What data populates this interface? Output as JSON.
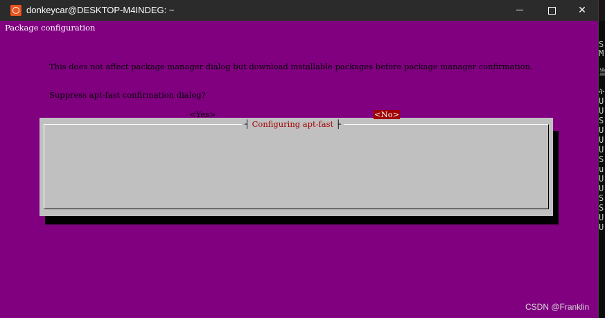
{
  "window": {
    "title": "donkeycar@DESKTOP-M4INDEG: ~",
    "minimize_glyph": "—",
    "maximize_glyph": "☐",
    "close_glyph": "✕",
    "app_icon": "ubuntu-icon"
  },
  "terminal": {
    "header": "Package configuration"
  },
  "dialog": {
    "title": "Configuring apt-fast",
    "body": "This does not affect package manager dialog but download installable packages before package manager confirmation.",
    "question": "Suppress apt-fast confirmation dialog?",
    "yes_label": "<Yes>",
    "no_label": "<No>",
    "selected": "No"
  },
  "background_window": {
    "fragments": [
      "S",
      "M",
      "当",
      "ት",
      "U",
      "U",
      "S",
      "U",
      "U",
      "U",
      "S",
      "u",
      "U",
      "U",
      "S",
      "S",
      "U",
      "U"
    ]
  },
  "watermark": "CSDN @Franklin",
  "colors": {
    "terminal_bg": "#800080",
    "dialog_bg": "#c0c0c0",
    "title_red": "#a00000",
    "selected_button_bg": "#a00000"
  }
}
